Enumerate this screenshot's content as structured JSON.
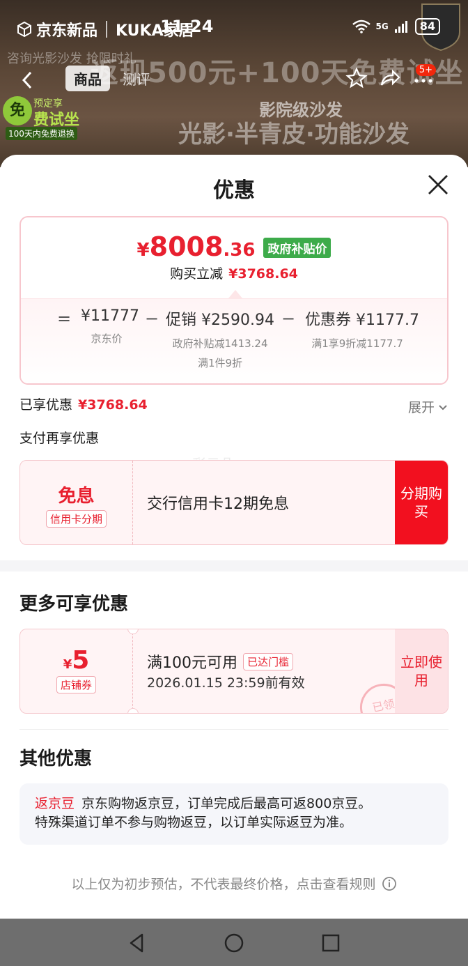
{
  "background": {
    "brand": "京东新品",
    "brand_sub": "KUKA家居",
    "banner": "返现500元+100天免费试坐",
    "promo_left": "咨询光影沙发 抢限时礼",
    "sub1": "影院级沙发",
    "sub2": "光影·半青皮·功能沙发",
    "free_circle": "免",
    "free_t1": "预定享",
    "free_t2": "费试坐",
    "free_t3": "100天内免费退换"
  },
  "status_bar": {
    "time": "11:24",
    "network": "5G",
    "battery": "84"
  },
  "navbar": {
    "tabs": [
      {
        "label": "商品"
      },
      {
        "label": "测评"
      }
    ],
    "msg_badge": "5+"
  },
  "sheet": {
    "title": "优惠",
    "price": {
      "yen": "¥",
      "int": "8008",
      "dec": ".36",
      "badge": "政府补贴价"
    },
    "save": {
      "label": "购买立减",
      "value": "¥3768.64"
    },
    "breakdown": {
      "eq": "=",
      "minus": "−",
      "jd_price": {
        "value": "¥11777",
        "label": "京东价"
      },
      "promo": {
        "value": "促销 ¥2590.94",
        "line1": "政府补贴减1413.24",
        "line2": "满1件9折"
      },
      "coupon": {
        "value": "优惠券 ¥1177.7",
        "line1": "满1享9折减1177.7"
      }
    },
    "enjoyed": {
      "label": "已享优惠",
      "value": "¥3768.64"
    },
    "expand_label": "展开",
    "pay_more": "支付再享优惠",
    "watermark": "彩云朵",
    "interest": {
      "big": "免息",
      "tag": "信用卡分期",
      "desc": "交行信用卡12期免息",
      "btn": "分期购买"
    },
    "more_title": "更多可享优惠",
    "shop_coupon": {
      "yen": "¥",
      "amount": "5",
      "tag": "店铺券",
      "condition": "满100元可用",
      "reached": "已达门槛",
      "expire": "2026.01.15 23:59前有效",
      "btn": "立即使用",
      "stamp": "已领"
    },
    "other_title": "其他优惠",
    "jd_beans": {
      "label": "返京豆",
      "line1": "京东购物返京豆，订单完成后最高可返800京豆。",
      "line2": "特殊渠道订单不参与购物返豆，以订单实际返豆为准。"
    },
    "disclaimer": "以上仅为初步预估，不代表最终价格，点击查看规则"
  },
  "colors": {
    "accent": "#e8202f",
    "gov_badge": "#3dab4a",
    "pink_bg": "#fff4f5"
  }
}
